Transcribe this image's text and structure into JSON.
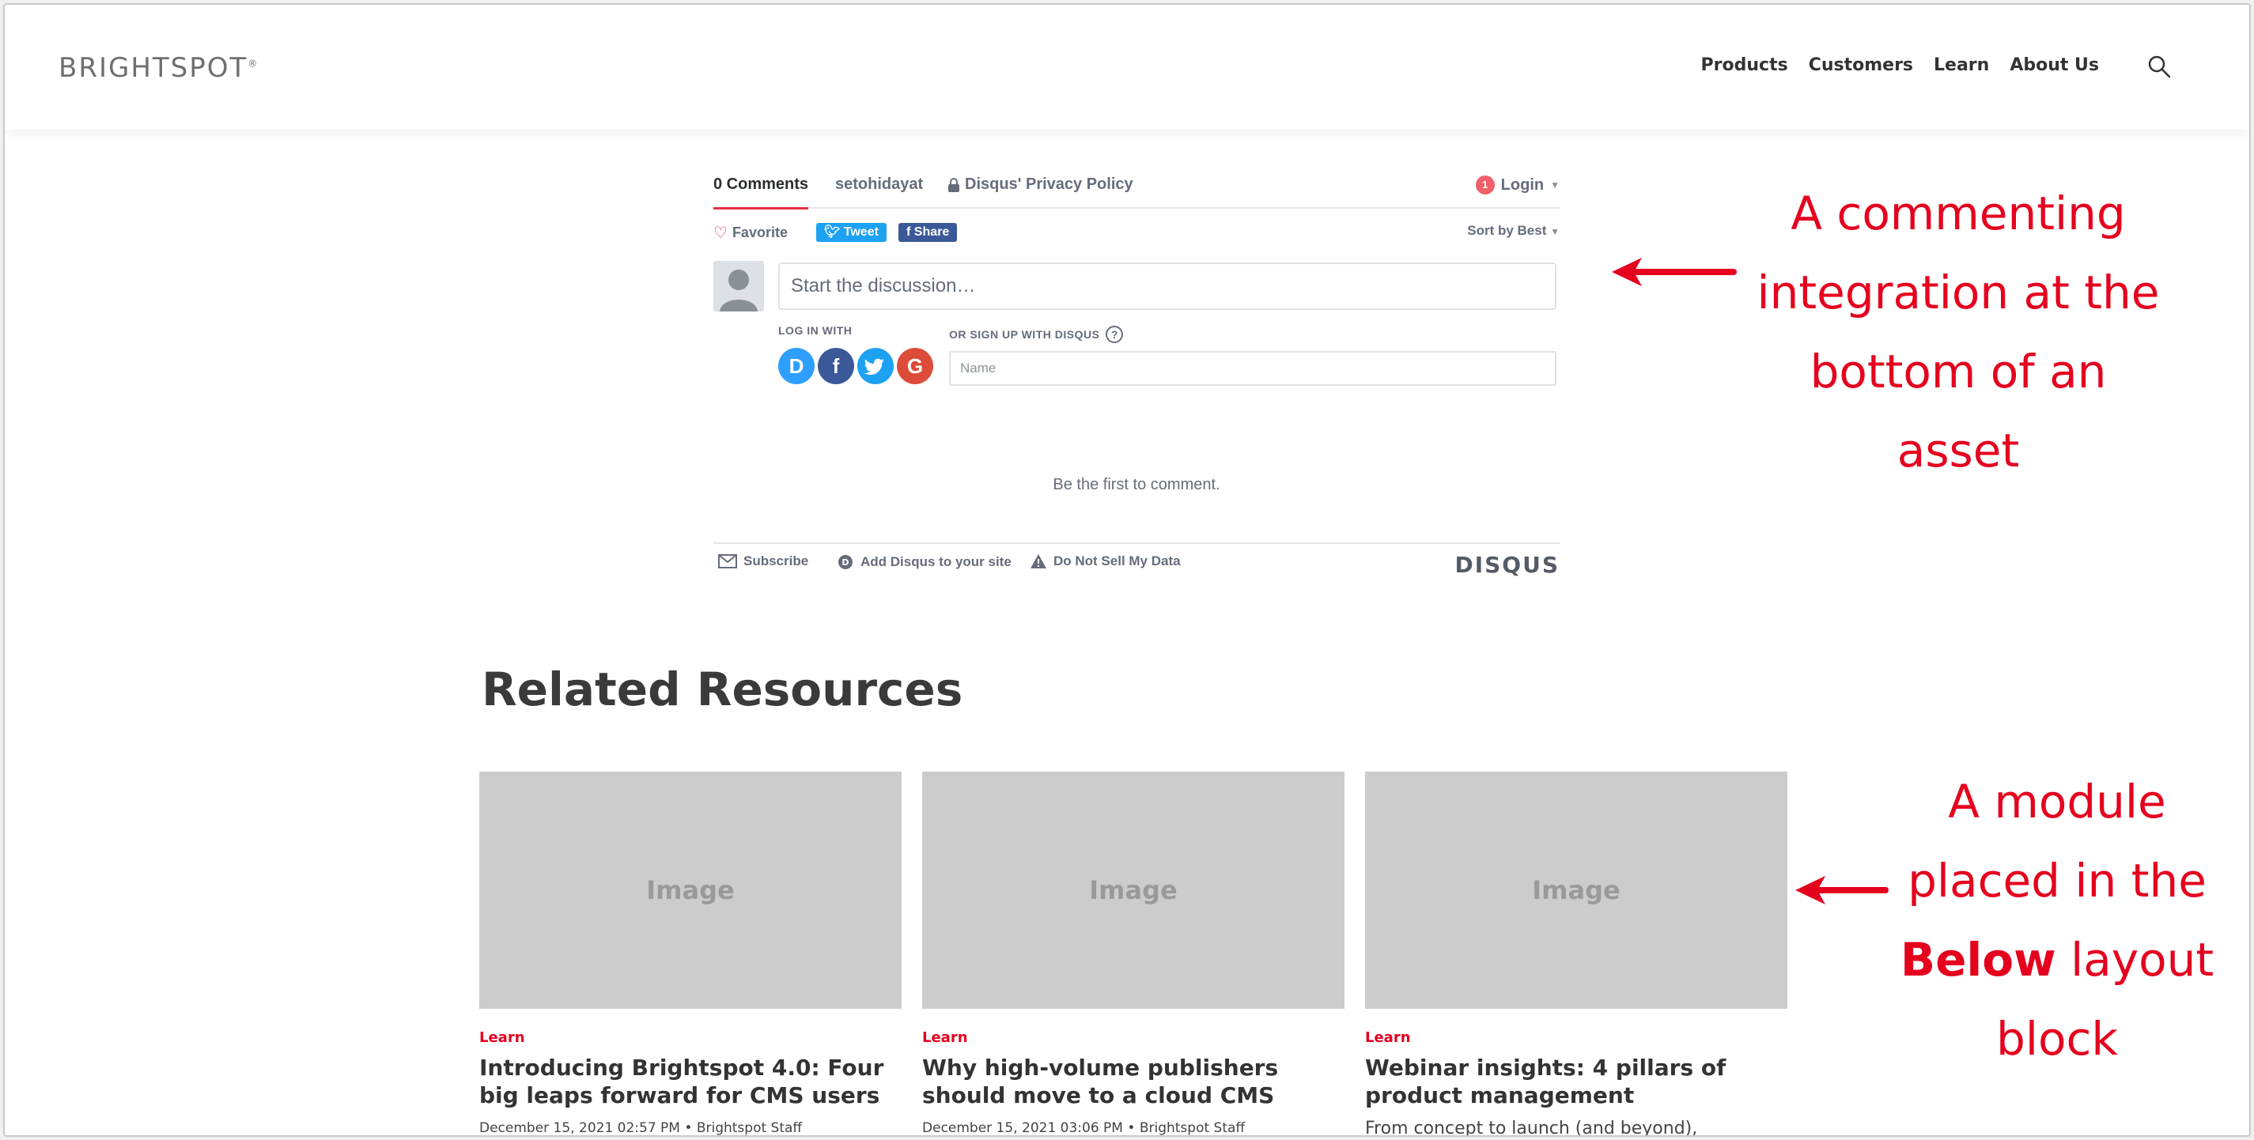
{
  "header": {
    "logo": "BRIGHTSPOT",
    "logo_reg": "®",
    "nav": [
      "Products",
      "Customers",
      "Learn",
      "About Us"
    ],
    "search_icon": "search-icon"
  },
  "disqus": {
    "tabs": {
      "comments": "0 Comments",
      "user": "setohidayat",
      "privacy": "Disqus' Privacy Policy"
    },
    "login": {
      "badge": "1",
      "label": "Login"
    },
    "favorite": "Favorite",
    "tweet": "Tweet",
    "share": "Share",
    "sort": "Sort by Best",
    "start_placeholder": "Start the discussion…",
    "login_with": "LOG IN WITH",
    "signup_with": "OR SIGN UP WITH DISQUS",
    "help": "?",
    "name_placeholder": "Name",
    "empty": "Be the first to comment.",
    "footer": {
      "subscribe": "Subscribe",
      "add": "Add Disqus to your site",
      "dns": "Do Not Sell My Data",
      "logo": "DISQUS"
    },
    "social": [
      "D",
      "f",
      "t",
      "G"
    ]
  },
  "related": {
    "title": "Related Resources",
    "cards": [
      {
        "image": "Image",
        "category": "Learn",
        "title": "Introducing Brightspot 4.0: Four big leaps forward for CMS users",
        "meta": "December 15, 2021 02:57 PM • Brightspot Staff",
        "desc": ""
      },
      {
        "image": "Image",
        "category": "Learn",
        "title": "Why high-volume publishers should move to a cloud CMS",
        "meta": "December 15, 2021 03:06 PM • Brightspot Staff",
        "desc": ""
      },
      {
        "image": "Image",
        "category": "Learn",
        "title": "Webinar insights: 4 pillars of product management",
        "meta": "",
        "desc": "From concept to launch (and beyond), successful"
      }
    ]
  },
  "annotations": {
    "a1": [
      "A commenting",
      "integration at the",
      "bottom of an",
      "asset"
    ],
    "a2_line1": "A module",
    "a2_line2": "placed in the",
    "a2_bold": "Below",
    "a2_rest": " layout",
    "a2_line4": "block"
  },
  "colors": {
    "accent": "#e5001e",
    "tweet": "#1da1f2",
    "share": "#3b5998"
  }
}
